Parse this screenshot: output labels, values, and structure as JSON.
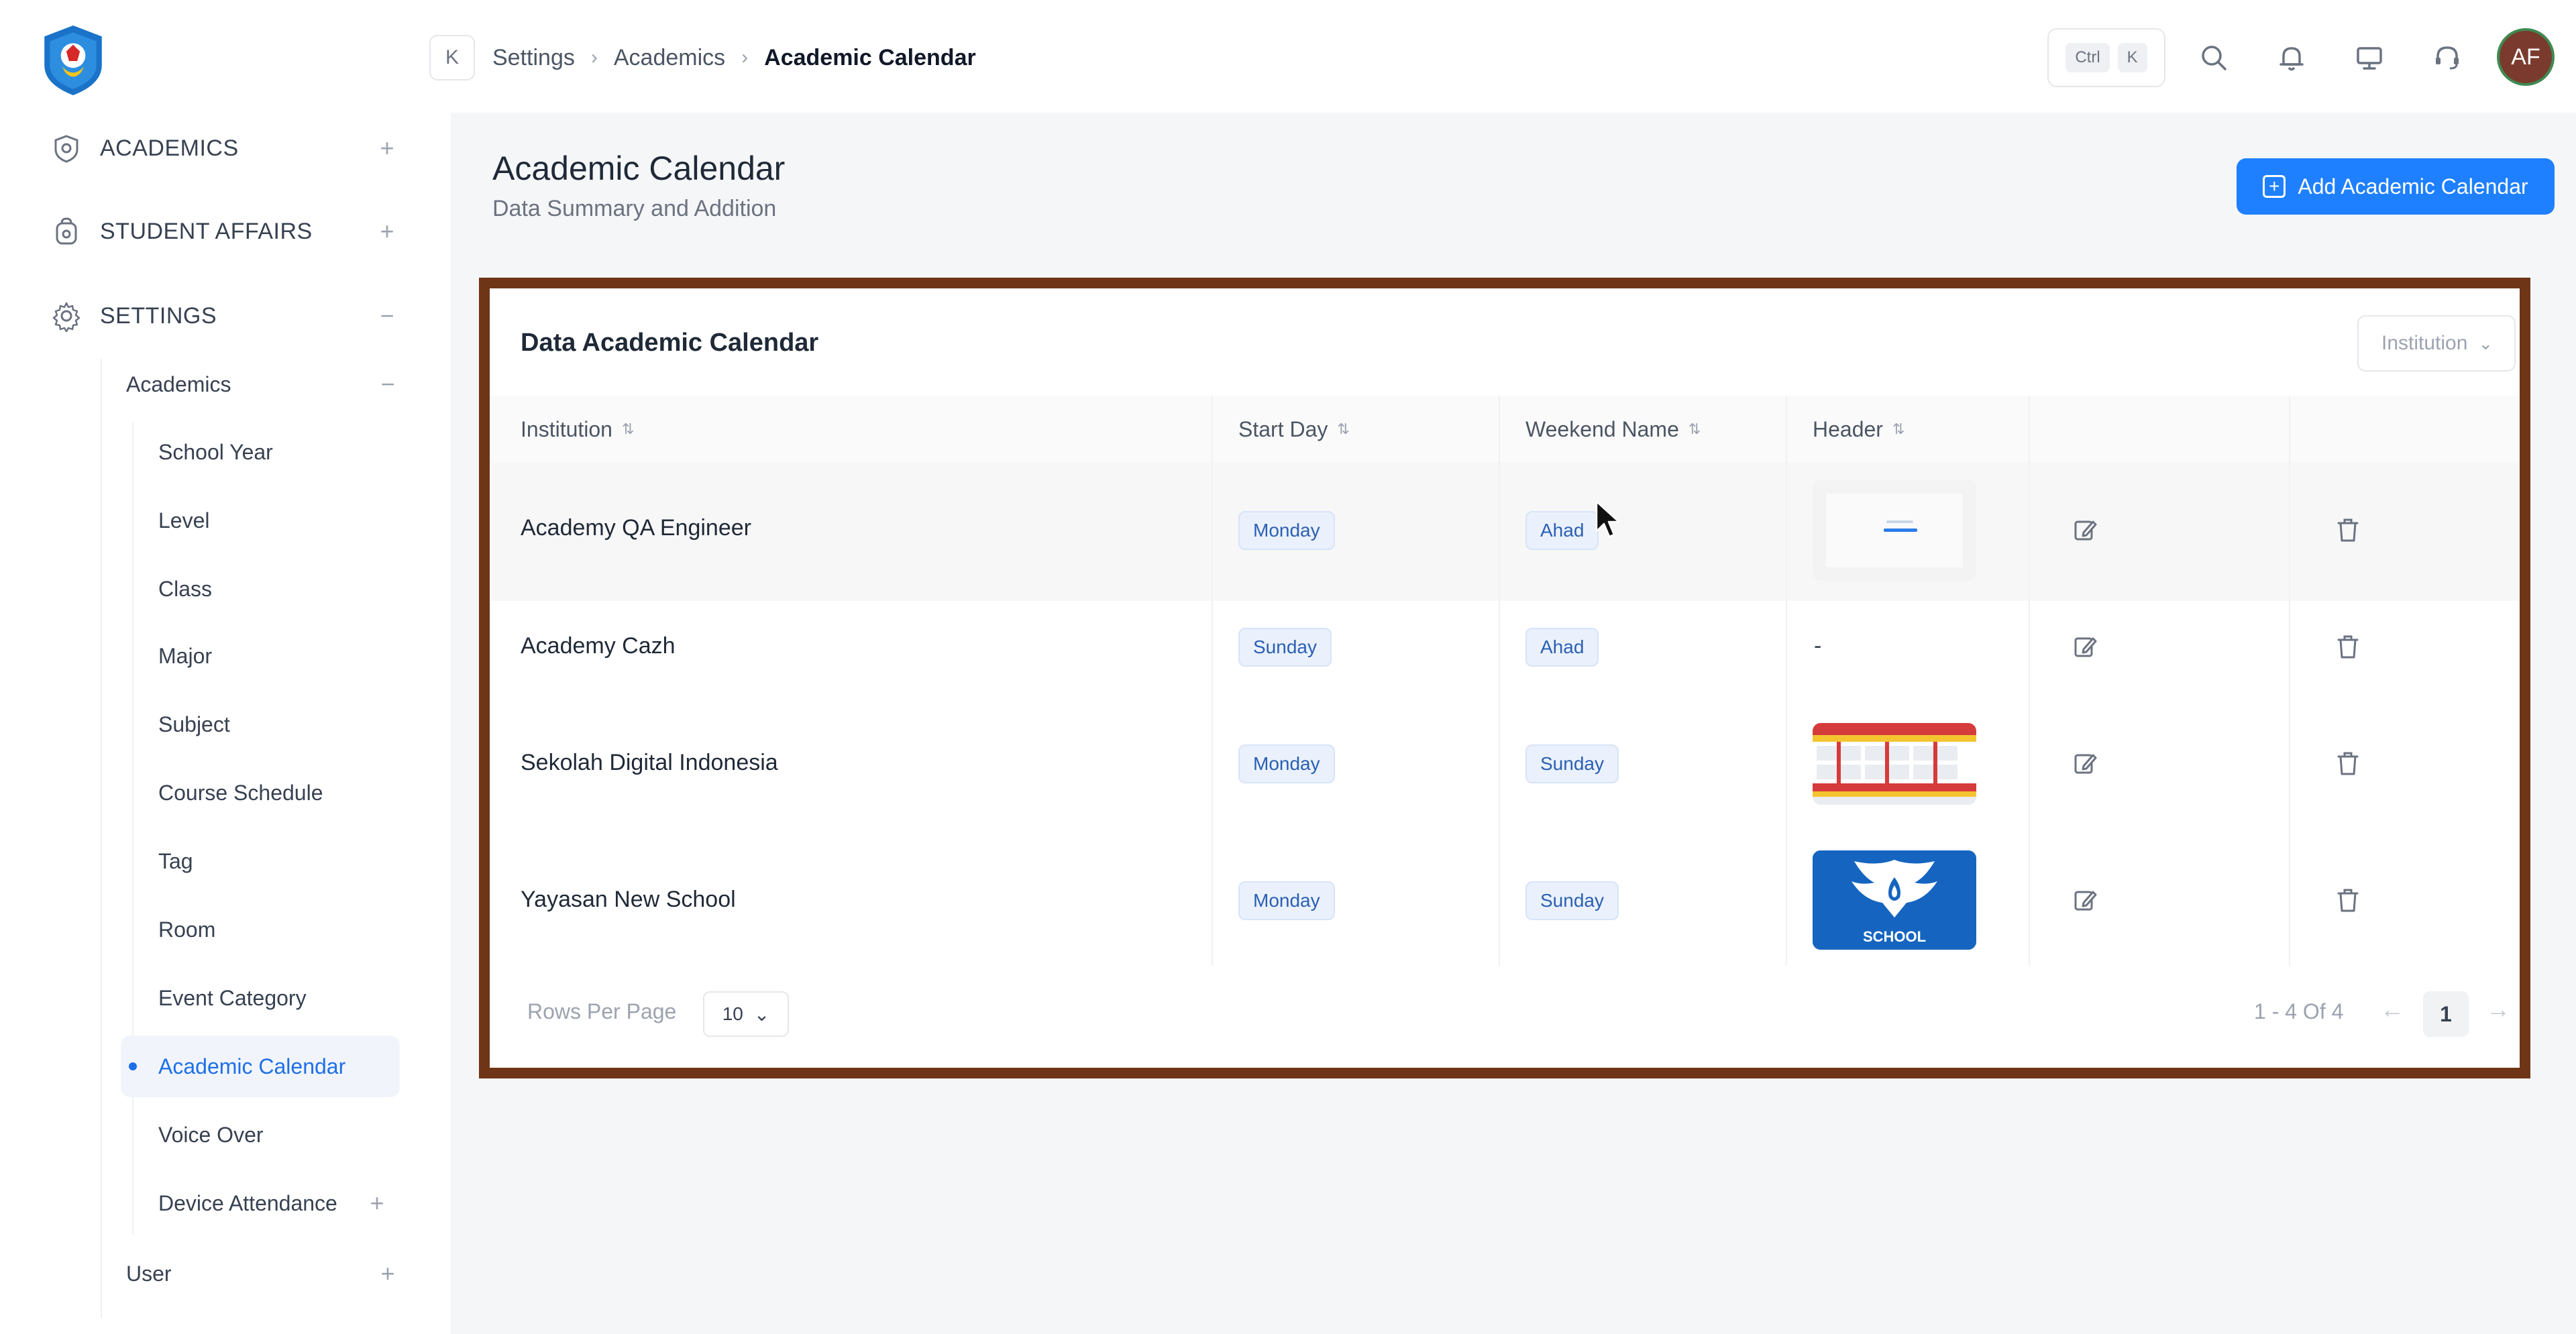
{
  "sidebar": {
    "sections": [
      {
        "label": "ACADEMICS",
        "toggle": "+"
      },
      {
        "label": "STUDENT AFFAIRS",
        "toggle": "+"
      },
      {
        "label": "SETTINGS",
        "toggle": "−"
      }
    ],
    "sub_group": {
      "label": "Academics",
      "toggle": "−"
    },
    "items": [
      {
        "label": "School Year"
      },
      {
        "label": "Level"
      },
      {
        "label": "Class"
      },
      {
        "label": "Major"
      },
      {
        "label": "Subject"
      },
      {
        "label": "Course Schedule"
      },
      {
        "label": "Tag"
      },
      {
        "label": "Room"
      },
      {
        "label": "Event Category"
      },
      {
        "label": "Academic Calendar",
        "active": true
      },
      {
        "label": "Voice Over"
      },
      {
        "label": "Device Attendance",
        "toggle": "+"
      }
    ],
    "user_group": {
      "label": "User",
      "toggle": "+"
    }
  },
  "header": {
    "breadcrumb": [
      "Settings",
      "Academics",
      "Academic Calendar"
    ],
    "shortcut": {
      "key1": "Ctrl",
      "key2": "K"
    },
    "avatar_initials": "AF",
    "collapse_glyph": "K"
  },
  "page": {
    "title": "Academic Calendar",
    "subtitle": "Data Summary and Addition",
    "add_button": "Add Academic Calendar"
  },
  "table": {
    "title": "Data Academic Calendar",
    "filter_placeholder": "Institution",
    "columns": [
      "Institution",
      "Start Day",
      "Weekend Name",
      "Header"
    ],
    "rows": [
      {
        "institution": "Academy QA Engineer",
        "start_day": "Monday",
        "weekend": "Ahad",
        "header": "image-blank"
      },
      {
        "institution": "Academy Cazh",
        "start_day": "Sunday",
        "weekend": "Ahad",
        "header": "-"
      },
      {
        "institution": "Sekolah Digital Indonesia",
        "start_day": "Monday",
        "weekend": "Sunday",
        "header": "image-calendar"
      },
      {
        "institution": "Yayasan New School",
        "start_day": "Monday",
        "weekend": "Sunday",
        "header": "image-school-logo"
      }
    ],
    "school_logo_text": "SCHOOL"
  },
  "pagination": {
    "rows_label": "Rows Per Page",
    "rows_value": "10",
    "range": "1 - 4 Of 4",
    "current_page": "1",
    "prev": "←",
    "next": "→"
  },
  "colors": {
    "accent": "#1e80ff",
    "frame": "#6e3516",
    "badge_bg": "#eaf1fc"
  }
}
